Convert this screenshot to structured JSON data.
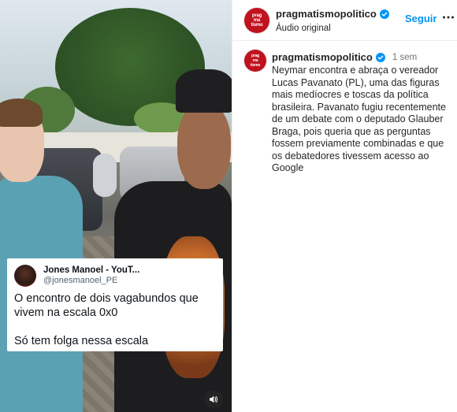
{
  "account": {
    "username": "pragmatismopolitico",
    "avatar_text": "prag\nma\ntismo",
    "avatar_color": "#c1121f",
    "verified_icon": "verified-badge-icon"
  },
  "header": {
    "subtitle": "Áudio original",
    "follow_label": "Seguir",
    "follow_color": "#0095f6",
    "more_icon": "more-options-icon"
  },
  "caption": {
    "time": "1 sem",
    "text": "Neymar encontra e abraça o vereador Lucas Pavanato (PL), uma das figuras mais medíocres e toscas da política brasileira. Pavanato fugiu recentemente de um debate com o deputado Glauber Braga, pois queria que as perguntas fossem previamente combinadas e que os debatedores tivessem acesso ao Google"
  },
  "media": {
    "quote": {
      "name": "Jones Manoel - YouT...",
      "handle": "@jonesmanoel_PE",
      "line1": "O encontro de dois vagabundos que vivem na escala 0x0",
      "line2": "Só tem folga nessa escala"
    },
    "sound_icon": "speaker-icon"
  }
}
